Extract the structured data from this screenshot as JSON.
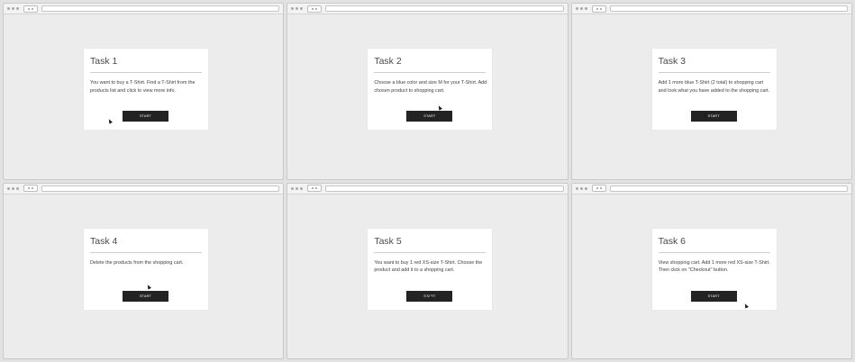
{
  "start_label": "START",
  "tasks": [
    {
      "title": "Task 1",
      "description": "You want to buy a T-Shirt. Find a T-Shirt from the products list and click to view more info."
    },
    {
      "title": "Task 2",
      "description": "Choose a blue color and size M for your T-Shirt. Add chosen product to shopping cart."
    },
    {
      "title": "Task 3",
      "description": "Add 1 more blue T-Shirt (2 total) to shopping cart and look what you have added to the shopping cart."
    },
    {
      "title": "Task 4",
      "description": "Delete the products from the shopping cart."
    },
    {
      "title": "Task 5",
      "description": "You want to buy 1 red XS-size T-Shirt. Choose the product and add it to a shopping cart."
    },
    {
      "title": "Task 6",
      "description": "View shopping cart. Add 1 more red XS-size T-Shirt. Then click on \"Checkout\" button."
    }
  ],
  "icons": {
    "window_controls": "window-controls-icon",
    "nav_buttons": "nav-buttons-icon",
    "cursor": "mouse-cursor-icon"
  },
  "colors": {
    "background": "#ececec",
    "card": "#ffffff",
    "button": "#232323",
    "button_text": "#ffffff"
  }
}
